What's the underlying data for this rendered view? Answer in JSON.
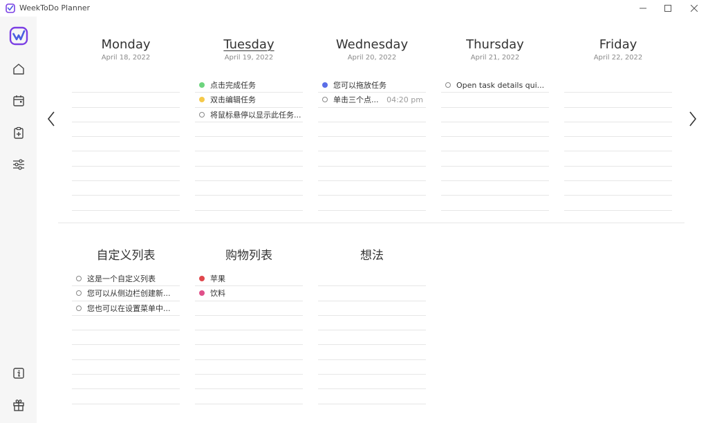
{
  "app": {
    "title": "WeekToDo Planner"
  },
  "colors": {
    "accent": "#7b3fe4",
    "green": "#6dd47e",
    "yellow": "#f5c94a",
    "blue": "#5b6ee8",
    "red": "#e0474c",
    "pink": "#e0508a"
  },
  "sidebar": {
    "items": [
      {
        "icon": "home-icon"
      },
      {
        "icon": "calendar-icon"
      },
      {
        "icon": "clipboard-icon"
      },
      {
        "icon": "sliders-icon"
      },
      {
        "icon": "info-icon"
      },
      {
        "icon": "gift-icon"
      }
    ]
  },
  "days": [
    {
      "name": "Monday",
      "date": "April 18, 2022",
      "today": false,
      "tasks": []
    },
    {
      "name": "Tuesday",
      "date": "April 19, 2022",
      "today": true,
      "tasks": [
        {
          "text": "点击完成任务",
          "color": "#6dd47e",
          "time": ""
        },
        {
          "text": "双击编辑任务",
          "color": "#f5c94a",
          "time": ""
        },
        {
          "text": "将鼠标悬停以显示此任务...",
          "color": "",
          "time": ""
        }
      ]
    },
    {
      "name": "Wednesday",
      "date": "April 20, 2022",
      "today": false,
      "tasks": [
        {
          "text": "您可以拖放任务",
          "color": "#5b6ee8",
          "time": ""
        },
        {
          "text": "单击三个点...",
          "color": "",
          "time": "04:20 pm"
        }
      ]
    },
    {
      "name": "Thursday",
      "date": "April 21, 2022",
      "today": false,
      "tasks": [
        {
          "text": "Open task details qui...",
          "color": "",
          "time": ""
        }
      ]
    },
    {
      "name": "Friday",
      "date": "April 22, 2022",
      "today": false,
      "tasks": []
    }
  ],
  "custom_lists": [
    {
      "name": "自定义列表",
      "tasks": [
        {
          "text": "这是一个自定义列表",
          "color": ""
        },
        {
          "text": "您可以从侧边栏创建新...",
          "color": ""
        },
        {
          "text": "您也可以在设置菜单中...",
          "color": ""
        }
      ]
    },
    {
      "name": "购物列表",
      "tasks": [
        {
          "text": "苹果",
          "color": "#e0474c"
        },
        {
          "text": "饮料",
          "color": "#e0508a"
        }
      ]
    },
    {
      "name": "想法",
      "tasks": []
    }
  ]
}
